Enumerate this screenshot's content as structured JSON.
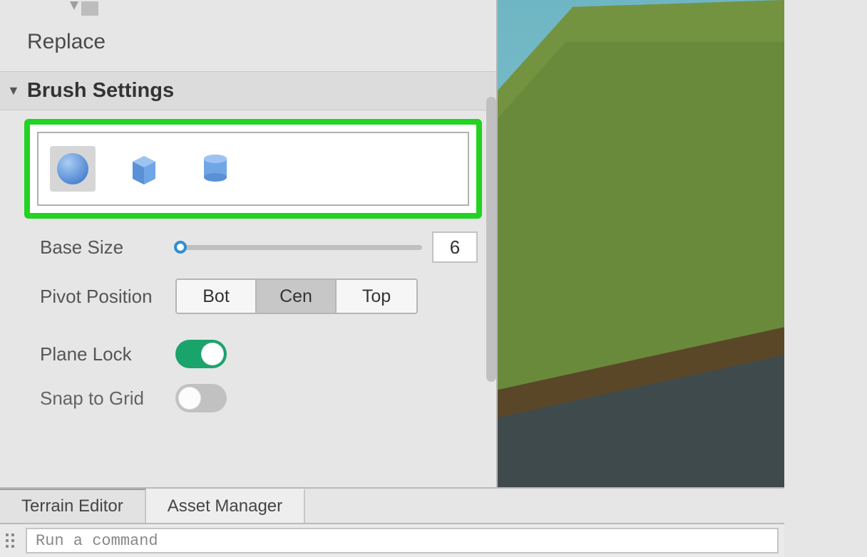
{
  "tool": {
    "replace_label": "Replace"
  },
  "section": {
    "title": "Brush Settings"
  },
  "shapes": {
    "options": [
      "sphere",
      "cube",
      "cylinder"
    ],
    "selected": "sphere"
  },
  "base_size": {
    "label": "Base Size",
    "value": "6",
    "slider_position": 0
  },
  "pivot": {
    "label": "Pivot Position",
    "options": [
      "Bot",
      "Cen",
      "Top"
    ],
    "selected": "Cen"
  },
  "plane_lock": {
    "label": "Plane Lock",
    "value": true
  },
  "snap_to_grid": {
    "label": "Snap to Grid",
    "value": false
  },
  "tabs": {
    "items": [
      "Terrain Editor",
      "Asset Manager"
    ],
    "active": "Terrain Editor"
  },
  "command_bar": {
    "placeholder": "Run a command"
  },
  "colors": {
    "highlight": "#22d322",
    "toggle_on": "#1aa36b",
    "shape_fill": "#6fa7e6"
  }
}
